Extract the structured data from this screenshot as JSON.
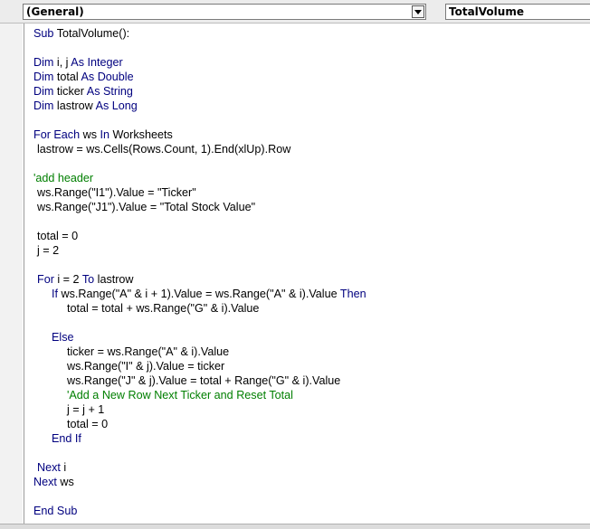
{
  "toolbar": {
    "object_box": "(General)",
    "procedure_box": "TotalVolume"
  },
  "icons": {
    "dropdown": "chevron-down-icon"
  },
  "colors": {
    "keyword": "#00007f",
    "comment": "#007f00",
    "text": "#000000"
  },
  "code_lines": [
    {
      "indent": 0,
      "segments": [
        {
          "t": "Sub",
          "k": "kw"
        },
        {
          "t": " TotalVolume():",
          "k": "tx"
        }
      ]
    },
    {
      "indent": 0,
      "segments": []
    },
    {
      "indent": 0,
      "segments": [
        {
          "t": "Dim",
          "k": "kw"
        },
        {
          "t": " i, j ",
          "k": "tx"
        },
        {
          "t": "As",
          "k": "kw"
        },
        {
          "t": " ",
          "k": "tx"
        },
        {
          "t": "Integer",
          "k": "kw"
        }
      ]
    },
    {
      "indent": 0,
      "segments": [
        {
          "t": "Dim",
          "k": "kw"
        },
        {
          "t": " total ",
          "k": "tx"
        },
        {
          "t": "As",
          "k": "kw"
        },
        {
          "t": " ",
          "k": "tx"
        },
        {
          "t": "Double",
          "k": "kw"
        }
      ]
    },
    {
      "indent": 0,
      "segments": [
        {
          "t": "Dim",
          "k": "kw"
        },
        {
          "t": " ticker ",
          "k": "tx"
        },
        {
          "t": "As",
          "k": "kw"
        },
        {
          "t": " ",
          "k": "tx"
        },
        {
          "t": "String",
          "k": "kw"
        }
      ]
    },
    {
      "indent": 0,
      "segments": [
        {
          "t": "Dim",
          "k": "kw"
        },
        {
          "t": " lastrow ",
          "k": "tx"
        },
        {
          "t": "As",
          "k": "kw"
        },
        {
          "t": " ",
          "k": "tx"
        },
        {
          "t": "Long",
          "k": "kw"
        }
      ]
    },
    {
      "indent": 0,
      "segments": []
    },
    {
      "indent": 0,
      "segments": [
        {
          "t": "For",
          "k": "kw"
        },
        {
          "t": " ",
          "k": "tx"
        },
        {
          "t": "Each",
          "k": "kw"
        },
        {
          "t": " ws ",
          "k": "tx"
        },
        {
          "t": "In",
          "k": "kw"
        },
        {
          "t": " Worksheets",
          "k": "tx"
        }
      ]
    },
    {
      "indent": 1,
      "segments": [
        {
          "t": "lastrow = ws.Cells(Rows.Count, 1).End(xlUp).Row",
          "k": "tx"
        }
      ]
    },
    {
      "indent": 0,
      "segments": []
    },
    {
      "indent": 0,
      "segments": [
        {
          "t": "'add header",
          "k": "cm"
        }
      ]
    },
    {
      "indent": 1,
      "segments": [
        {
          "t": "ws.Range(\"I1\").Value = \"Ticker\"",
          "k": "tx"
        }
      ]
    },
    {
      "indent": 1,
      "segments": [
        {
          "t": "ws.Range(\"J1\").Value = \"Total Stock Value\"",
          "k": "tx"
        }
      ]
    },
    {
      "indent": 0,
      "segments": []
    },
    {
      "indent": 1,
      "segments": [
        {
          "t": "total = 0",
          "k": "tx"
        }
      ]
    },
    {
      "indent": 1,
      "segments": [
        {
          "t": "j = 2",
          "k": "tx"
        }
      ]
    },
    {
      "indent": 0,
      "segments": []
    },
    {
      "indent": 1,
      "segments": [
        {
          "t": "For",
          "k": "kw"
        },
        {
          "t": " i = 2 ",
          "k": "tx"
        },
        {
          "t": "To",
          "k": "kw"
        },
        {
          "t": " lastrow",
          "k": "tx"
        }
      ]
    },
    {
      "indent": 2,
      "segments": [
        {
          "t": "If",
          "k": "kw"
        },
        {
          "t": " ws.Range(\"A\" & i + 1).Value = ws.Range(\"A\" & i).Value ",
          "k": "tx"
        },
        {
          "t": "Then",
          "k": "kw"
        }
      ]
    },
    {
      "indent": 3,
      "segments": [
        {
          "t": "total = total + ws.Range(\"G\" & i).Value",
          "k": "tx"
        }
      ]
    },
    {
      "indent": 0,
      "segments": []
    },
    {
      "indent": 2,
      "segments": [
        {
          "t": "Else",
          "k": "kw"
        }
      ]
    },
    {
      "indent": 3,
      "segments": [
        {
          "t": "ticker = ws.Range(\"A\" & i).Value",
          "k": "tx"
        }
      ]
    },
    {
      "indent": 3,
      "segments": [
        {
          "t": "ws.Range(\"I\" & j).Value = ticker",
          "k": "tx"
        }
      ]
    },
    {
      "indent": 3,
      "segments": [
        {
          "t": "ws.Range(\"J\" & j).Value = total + Range(\"G\" & i).Value",
          "k": "tx"
        }
      ]
    },
    {
      "indent": 3,
      "segments": [
        {
          "t": "'Add a New Row Next Ticker and Reset Total",
          "k": "cm"
        }
      ]
    },
    {
      "indent": 3,
      "segments": [
        {
          "t": "j = j + 1",
          "k": "tx"
        }
      ]
    },
    {
      "indent": 3,
      "segments": [
        {
          "t": "total = 0",
          "k": "tx"
        }
      ]
    },
    {
      "indent": 2,
      "segments": [
        {
          "t": "End",
          "k": "kw"
        },
        {
          "t": " ",
          "k": "tx"
        },
        {
          "t": "If",
          "k": "kw"
        }
      ]
    },
    {
      "indent": 0,
      "segments": []
    },
    {
      "indent": 1,
      "segments": [
        {
          "t": "Next",
          "k": "kw"
        },
        {
          "t": " i",
          "k": "tx"
        }
      ]
    },
    {
      "indent": 0,
      "segments": [
        {
          "t": "Next",
          "k": "kw"
        },
        {
          "t": " ws",
          "k": "tx"
        }
      ]
    },
    {
      "indent": 0,
      "segments": []
    },
    {
      "indent": 0,
      "segments": [
        {
          "t": "End",
          "k": "kw"
        },
        {
          "t": " ",
          "k": "tx"
        },
        {
          "t": "Sub",
          "k": "kw"
        }
      ]
    }
  ]
}
